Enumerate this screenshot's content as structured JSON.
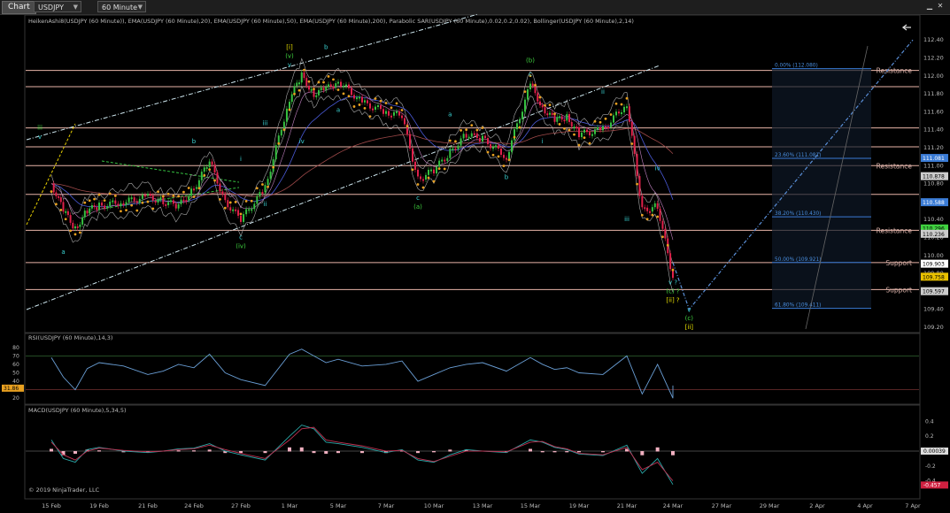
{
  "toolbar": {
    "chart_tab": "Chart",
    "instrument": "USDJPY",
    "interval": "60 Minute",
    "arrow": "▼"
  },
  "colors": {
    "background": "#000000",
    "candle_up": "#35c040",
    "candle_down": "#e0204a",
    "sar": "#e8a020",
    "resistance_line": "#e8b4a8",
    "fib_line": "#3a7bd5",
    "projection": "#5a8fd8",
    "rsi": "#6a9fd6",
    "wave_green": "#3fd13f",
    "wave_cyan": "#3ad4d4",
    "wave_yellow": "#e8e000"
  },
  "chart_data": [
    {
      "type": "candlestick",
      "panel": "price",
      "indicators_label": "HeikenAshi8(USDJPY (60 Minute)), EMA(USDJPY (60 Minute),20), EMA(USDJPY (60 Minute),50), EMA(USDJPY (60 Minute),200), Parabolic SAR(USDJPY (60 Minute),0.02,0.2,0.02), Bollinger(USDJPY (60 Minute),2,14)",
      "x_ticks": [
        "15 Feb",
        "19 Feb",
        "21 Feb",
        "24 Feb",
        "27 Feb",
        "1 Mar",
        "5 Mar",
        "7 Mar",
        "10 Mar",
        "13 Mar",
        "15 Mar",
        "19 Mar",
        "21 Mar",
        "24 Mar",
        "27 Mar",
        "29 Mar",
        "2 Apr",
        "4 Apr",
        "7 Apr"
      ],
      "y_ticks": [
        112.4,
        112.2,
        112.0,
        111.8,
        111.6,
        111.4,
        111.2,
        111.0,
        110.8,
        110.6,
        110.4,
        110.2,
        110.0,
        109.8,
        109.6,
        109.4,
        109.2
      ],
      "y_tick_labels": [
        "112.40",
        "112.20",
        "112.00",
        "111.80",
        "111.60",
        "111.40",
        "111.20",
        "111.00",
        "110.80",
        "110.60",
        "110.40",
        "110.20",
        "110.00",
        "109.80",
        "109.60",
        "109.40",
        "109.20"
      ],
      "ylim": [
        109.2,
        112.5
      ],
      "price_path": [
        {
          "x": "15 Feb",
          "y": 110.8
        },
        {
          "x": "16 Feb",
          "y": 110.5
        },
        {
          "x": "17 Feb",
          "y": 110.3
        },
        {
          "x": "18 Feb",
          "y": 110.5
        },
        {
          "x": "19 Feb",
          "y": 110.55
        },
        {
          "x": "20 Feb",
          "y": 110.6
        },
        {
          "x": "21 Feb",
          "y": 110.65
        },
        {
          "x": "22 Feb",
          "y": 110.6
        },
        {
          "x": "23 Feb",
          "y": 110.55
        },
        {
          "x": "24 Feb",
          "y": 110.75
        },
        {
          "x": "25 Feb",
          "y": 111.05
        },
        {
          "x": "26 Feb",
          "y": 110.6
        },
        {
          "x": "27 Feb",
          "y": 110.4
        },
        {
          "x": "28 Feb",
          "y": 110.75
        },
        {
          "x": "1 Mar",
          "y": 111.75
        },
        {
          "x": "2 Mar",
          "y": 112.0
        },
        {
          "x": "3 Mar",
          "y": 111.8
        },
        {
          "x": "4 Mar",
          "y": 111.85
        },
        {
          "x": "5 Mar",
          "y": 111.95
        },
        {
          "x": "6 Mar",
          "y": 111.7
        },
        {
          "x": "7 Mar",
          "y": 111.6
        },
        {
          "x": "8 Mar",
          "y": 111.55
        },
        {
          "x": "9 Mar",
          "y": 110.85
        },
        {
          "x": "10 Mar",
          "y": 110.95
        },
        {
          "x": "11 Mar",
          "y": 111.15
        },
        {
          "x": "12 Mar",
          "y": 111.35
        },
        {
          "x": "13 Mar",
          "y": 111.3
        },
        {
          "x": "14 Mar",
          "y": 111.1
        },
        {
          "x": "15 Mar",
          "y": 111.9
        },
        {
          "x": "16 Mar",
          "y": 111.65
        },
        {
          "x": "17 Mar",
          "y": 111.5
        },
        {
          "x": "18 Mar",
          "y": 111.55
        },
        {
          "x": "19 Mar",
          "y": 111.35
        },
        {
          "x": "20 Mar",
          "y": 111.4
        },
        {
          "x": "21 Mar",
          "y": 111.7
        },
        {
          "x": "22 Mar",
          "y": 110.5
        },
        {
          "x": "23 Mar",
          "y": 110.55
        },
        {
          "x": "24 Mar",
          "y": 109.75
        }
      ],
      "horizontal_levels": [
        {
          "price": 112.06,
          "label": "Resistance",
          "style": "resistance"
        },
        {
          "price": 111.88,
          "label": "",
          "style": "resistance"
        },
        {
          "price": 111.42,
          "label": "",
          "style": "resistance"
        },
        {
          "price": 111.21,
          "label": "",
          "style": "resistance"
        },
        {
          "price": 111.0,
          "label": "Resistance",
          "style": "resistance"
        },
        {
          "price": 110.68,
          "label": "",
          "style": "resistance"
        },
        {
          "price": 110.28,
          "label": "Resistance",
          "style": "resistance"
        },
        {
          "price": 109.92,
          "label": "Support",
          "style": "resistance"
        },
        {
          "price": 109.62,
          "label": "Support",
          "style": "resistance"
        }
      ],
      "fibonacci": [
        {
          "label": "0.00% (112.080)",
          "price": 112.08
        },
        {
          "label": "23.60% (111.081)",
          "price": 111.081
        },
        {
          "label": "38.20% (110.430)",
          "price": 110.43
        },
        {
          "label": "50.00% (109.921)",
          "price": 109.921
        },
        {
          "label": "61.80% (109.411)",
          "price": 109.411
        }
      ],
      "price_markers": [
        {
          "label": "111.081",
          "price": 111.081,
          "color": "#3a7bd5"
        },
        {
          "label": "110.878",
          "price": 110.878,
          "color": "#cccccc"
        },
        {
          "label": "110.588",
          "price": 110.588,
          "color": "#3a7bd5"
        },
        {
          "label": "110.296",
          "price": 110.296,
          "color": "#3fd13f"
        },
        {
          "label": "110.236",
          "price": 110.236,
          "color": "#cccccc"
        },
        {
          "label": "109.903",
          "price": 109.903,
          "color": "#ffffff"
        },
        {
          "label": "109.758",
          "price": 109.758,
          "color": "#e8c000"
        },
        {
          "label": "109.597",
          "price": 109.597,
          "color": "#cccccc"
        }
      ],
      "wave_labels": [
        {
          "text": "[i]",
          "x": "1 Mar",
          "y": 112.3,
          "color": "#e8e000"
        },
        {
          "text": "(v)",
          "x": "1 Mar",
          "y": 112.2,
          "color": "#3fd13f"
        },
        {
          "text": "v",
          "x": "1 Mar",
          "y": 112.1,
          "color": "#3ad4d4"
        },
        {
          "text": "b",
          "x": "4 Mar",
          "y": 112.3,
          "color": "#3ad4d4"
        },
        {
          "text": "(b)",
          "x": "15 Mar",
          "y": 112.15,
          "color": "#3fd13f"
        },
        {
          "text": "c",
          "x": "15 Mar",
          "y": 112.0,
          "color": "#3ad4d4"
        },
        {
          "text": "ii",
          "x": "20 Mar",
          "y": 111.8,
          "color": "#3ad4d4"
        },
        {
          "text": "a",
          "x": "11 Mar",
          "y": 111.55,
          "color": "#3ad4d4"
        },
        {
          "text": "a",
          "x": "5 Mar",
          "y": 111.6,
          "color": "#3ad4d4"
        },
        {
          "text": "iii",
          "x": "28 Feb",
          "y": 111.45,
          "color": "#3ad4d4"
        },
        {
          "text": "iv",
          "x": "2 Mar",
          "y": 111.25,
          "color": "#3ad4d4"
        },
        {
          "text": "i",
          "x": "27 Feb",
          "y": 111.05,
          "color": "#3ad4d4"
        },
        {
          "text": "ii",
          "x": "28 Feb",
          "y": 110.55,
          "color": "#3ad4d4"
        },
        {
          "text": "b",
          "x": "24 Feb",
          "y": 111.25,
          "color": "#3ad4d4"
        },
        {
          "text": "c",
          "x": "27 Feb",
          "y": 110.18,
          "color": "#3ad4d4"
        },
        {
          "text": "(iv)",
          "x": "27 Feb",
          "y": 110.08,
          "color": "#3fd13f"
        },
        {
          "text": "a",
          "x": "16 Feb",
          "y": 110.02,
          "color": "#3ad4d4"
        },
        {
          "text": "iii",
          "x": "14 Feb",
          "y": 111.4,
          "color": "#3fd13f"
        },
        {
          "text": "v",
          "x": "14 Feb",
          "y": 111.3,
          "color": "#3ad4d4"
        },
        {
          "text": "c",
          "x": "9 Mar",
          "y": 110.62,
          "color": "#3ad4d4"
        },
        {
          "text": "(a)",
          "x": "9 Mar",
          "y": 110.52,
          "color": "#3fd13f"
        },
        {
          "text": "b",
          "x": "14 Mar",
          "y": 110.85,
          "color": "#3ad4d4"
        },
        {
          "text": "i",
          "x": "16 Mar",
          "y": 111.25,
          "color": "#3ad4d4"
        },
        {
          "text": "iii",
          "x": "21 Mar",
          "y": 110.38,
          "color": "#3ad4d4"
        },
        {
          "text": "iv",
          "x": "23 Mar",
          "y": 110.95,
          "color": "#3ad4d4"
        },
        {
          "text": "v ?",
          "x": "24 Mar",
          "y": 109.68,
          "color": "#3ad4d4"
        },
        {
          "text": "(c) ?",
          "x": "24 Mar",
          "y": 109.58,
          "color": "#3fd13f"
        },
        {
          "text": "[ii] ?",
          "x": "24 Mar",
          "y": 109.48,
          "color": "#e8e000"
        },
        {
          "text": "v",
          "x": "25 Mar",
          "y": 109.37,
          "color": "#3ad4d4"
        },
        {
          "text": "(c)",
          "x": "25 Mar",
          "y": 109.28,
          "color": "#3fd13f"
        },
        {
          "text": "[ii]",
          "x": "25 Mar",
          "y": 109.18,
          "color": "#e8e000"
        }
      ],
      "projection": [
        {
          "x": "24 Mar",
          "y": 109.92
        },
        {
          "x": "25 Mar",
          "y": 109.4
        },
        {
          "x": "7 Apr",
          "y": 112.4
        }
      ],
      "grid": false
    },
    {
      "type": "line",
      "panel": "rsi",
      "title": "RSI(USDJPY (60 Minute),14,3)",
      "y_ticks": [
        "80",
        "70",
        "60",
        "50",
        "40",
        "30",
        "20"
      ],
      "current_value": "31.86",
      "series": [
        {
          "name": "RSI",
          "values": [
            68,
            45,
            30,
            55,
            62,
            58,
            48,
            52,
            60,
            56,
            72,
            50,
            42,
            35,
            72,
            78,
            70,
            62,
            66,
            58,
            60,
            64,
            40,
            48,
            56,
            60,
            62,
            52,
            68,
            60,
            54,
            56,
            50,
            48,
            70,
            25,
            60,
            20,
            35
          ]
        }
      ]
    },
    {
      "type": "line",
      "panel": "macd",
      "title": "MACD(USDJPY (60 Minute),5,34,5)",
      "y_ticks": [
        "0.4",
        "0.2",
        "0",
        "-0.2",
        "-0.4"
      ],
      "current_values": [
        "0.00039",
        "-0.457"
      ],
      "series": [
        {
          "name": "MACD",
          "values": [
            0.15,
            -0.1,
            -0.15,
            0.02,
            0.05,
            0.0,
            -0.02,
            0.0,
            0.03,
            0.04,
            0.1,
            0.0,
            -0.05,
            -0.12,
            0.2,
            0.35,
            0.3,
            0.12,
            0.1,
            0.05,
            -0.02,
            0.02,
            -0.12,
            -0.15,
            -0.05,
            0.02,
            0.0,
            -0.02,
            0.15,
            0.12,
            0.05,
            0.02,
            -0.04,
            -0.06,
            0.08,
            -0.3,
            -0.1,
            -0.45
          ]
        },
        {
          "name": "Signal",
          "values": [
            0.12,
            -0.05,
            -0.12,
            0.0,
            0.04,
            0.01,
            -0.01,
            0.0,
            0.02,
            0.03,
            0.08,
            0.02,
            -0.03,
            -0.1,
            0.15,
            0.3,
            0.32,
            0.15,
            0.12,
            0.07,
            0.0,
            0.01,
            -0.1,
            -0.14,
            -0.07,
            0.0,
            0.0,
            -0.01,
            0.12,
            0.13,
            0.06,
            0.03,
            -0.03,
            -0.05,
            0.05,
            -0.25,
            -0.15,
            -0.4
          ]
        }
      ]
    }
  ],
  "footer": {
    "copyright": "© 2019 NinjaTrader, LLC"
  }
}
